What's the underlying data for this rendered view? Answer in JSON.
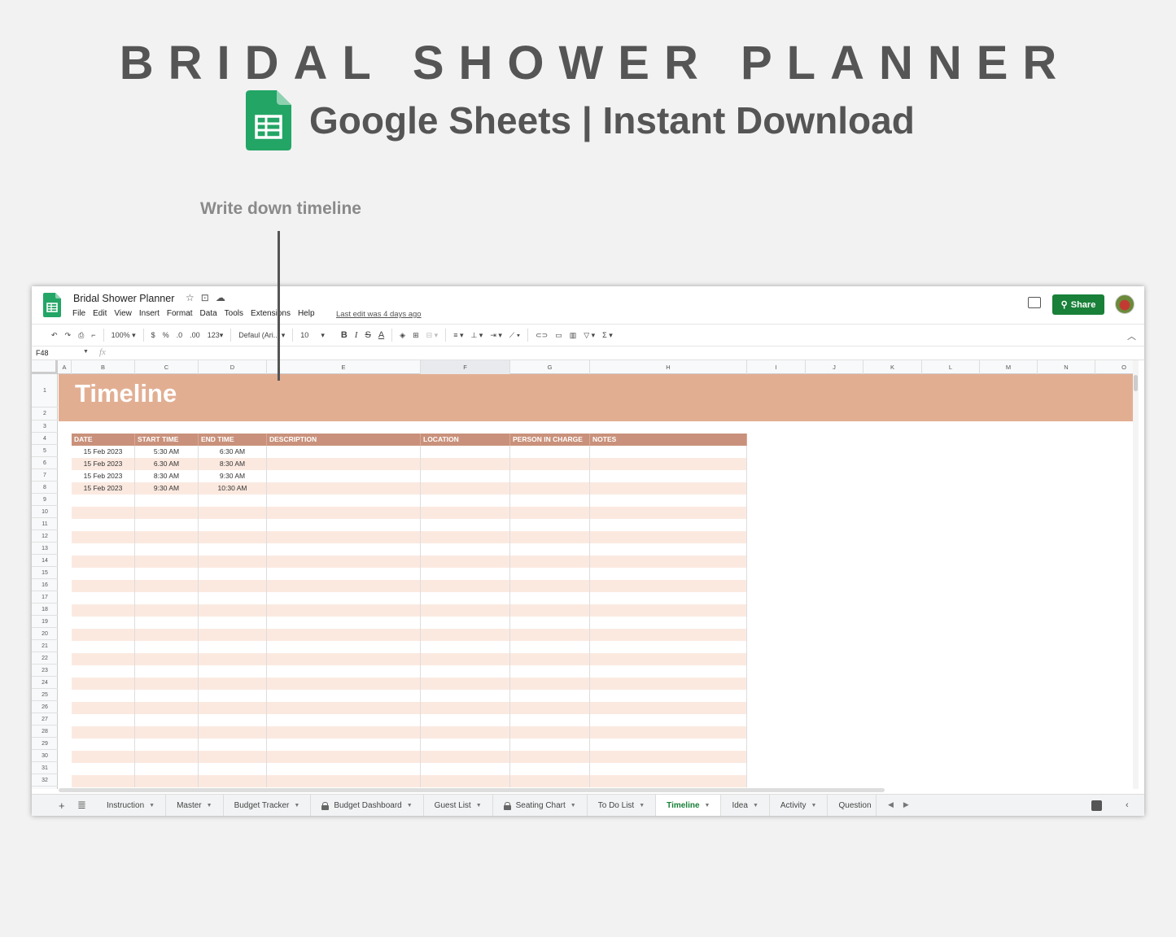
{
  "banner": {
    "title": "BRIDAL SHOWER PLANNER",
    "subtitle": "Google Sheets | Instant Download",
    "annotation": "Write down timeline"
  },
  "app": {
    "doc_title": "Bridal Shower Planner",
    "menu": [
      "File",
      "Edit",
      "View",
      "Insert",
      "Format",
      "Data",
      "Tools",
      "Extensions",
      "Help"
    ],
    "last_edit": "Last edit was 4 days ago",
    "share_label": "Share",
    "brand_color": "#188038",
    "sheets_icon_color": "#23a566"
  },
  "toolbar": {
    "zoom": "100%",
    "currency": "$",
    "percent": "%",
    "dec_decrease": ".0",
    "dec_increase": ".00",
    "format_more": "123",
    "font": "Defaul (Ari...",
    "font_size": "10",
    "bold": "B",
    "italic": "I",
    "strike": "S",
    "text_color": "A",
    "sum": "Σ"
  },
  "formula_bar": {
    "name_box": "F48",
    "fx": "fx"
  },
  "columns": [
    "A",
    "B",
    "C",
    "D",
    "E",
    "F",
    "G",
    "H",
    "I",
    "J",
    "K",
    "L",
    "M",
    "N",
    "O"
  ],
  "rows": [
    "1",
    "2",
    "3",
    "4",
    "5",
    "6",
    "7",
    "8",
    "9",
    "10",
    "11",
    "12",
    "13",
    "14",
    "15",
    "16",
    "17",
    "18",
    "19",
    "20",
    "21",
    "22",
    "23",
    "24",
    "25",
    "26",
    "27",
    "28",
    "29",
    "30",
    "31",
    "32"
  ],
  "sheet": {
    "title": "Timeline",
    "header_color": "#e2ae92",
    "table_header_color": "#c9917b",
    "stripe_color": "#fbe9e0",
    "headers": [
      "DATE",
      "START TIME",
      "END TIME",
      "DESCRIPTION",
      "LOCATION",
      "PERSON IN CHARGE",
      "NOTES"
    ],
    "entries": [
      [
        "15 Feb 2023",
        "5:30 AM",
        "6:30 AM",
        "",
        "",
        "",
        ""
      ],
      [
        "15 Feb 2023",
        "6.30 AM",
        "8:30 AM",
        "",
        "",
        "",
        ""
      ],
      [
        "15 Feb 2023",
        "8:30 AM",
        "9:30 AM",
        "",
        "",
        "",
        ""
      ],
      [
        "15 Feb 2023",
        "9:30 AM",
        "10:30 AM",
        "",
        "",
        "",
        ""
      ]
    ]
  },
  "tabs": [
    {
      "label": "Instruction",
      "locked": false,
      "active": false
    },
    {
      "label": "Master",
      "locked": false,
      "active": false
    },
    {
      "label": "Budget Tracker",
      "locked": false,
      "active": false
    },
    {
      "label": "Budget Dashboard",
      "locked": true,
      "active": false
    },
    {
      "label": "Guest List",
      "locked": false,
      "active": false
    },
    {
      "label": "Seating Chart",
      "locked": true,
      "active": false
    },
    {
      "label": "To Do List",
      "locked": false,
      "active": false
    },
    {
      "label": "Timeline",
      "locked": false,
      "active": true
    },
    {
      "label": "Idea",
      "locked": false,
      "active": false
    },
    {
      "label": "Activity",
      "locked": false,
      "active": false
    },
    {
      "label": "Question",
      "locked": false,
      "active": false
    }
  ]
}
